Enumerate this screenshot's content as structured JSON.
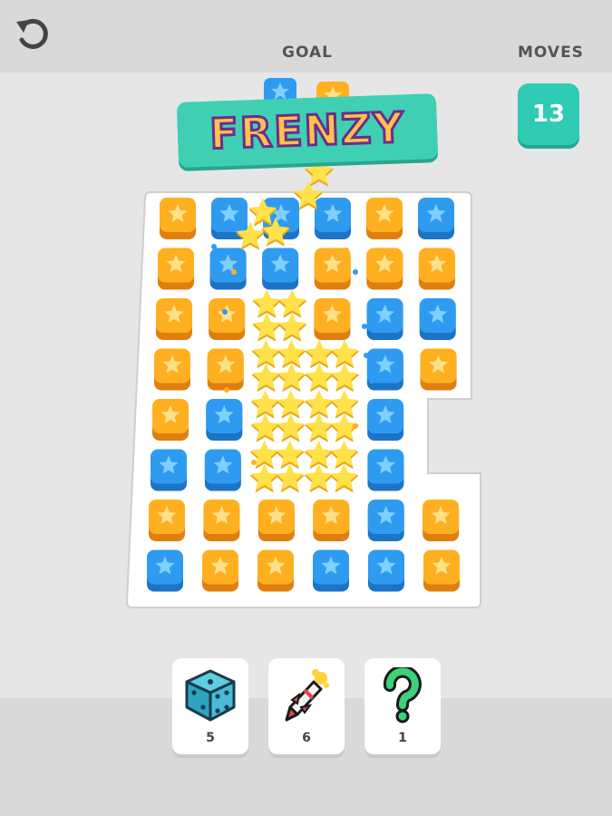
{
  "hud": {
    "goal_label": "GOAL",
    "moves_label": "MOVES",
    "moves_left": "13",
    "undo_icon": "undo-arrow-icon",
    "goal_tiles": [
      "blue-star",
      "orange-star"
    ]
  },
  "banner": {
    "text": "FRENZY"
  },
  "colors": {
    "blue_tile": "#2f9bf0",
    "orange_tile": "#ffb020",
    "star_burst": "#ffe24a",
    "accent_teal": "#2fcbb3"
  },
  "board": {
    "rows": [
      [
        "O",
        "B",
        "B",
        "B",
        "O",
        "B"
      ],
      [
        "O",
        "B",
        "B",
        "O",
        "O",
        "O"
      ],
      [
        "O",
        "O",
        "S",
        "O",
        "B",
        "B"
      ],
      [
        "O",
        "O",
        "S",
        "S",
        "B",
        "O"
      ],
      [
        "O",
        "B",
        "S",
        "S",
        "B",
        ""
      ],
      [
        "B",
        "B",
        "S",
        "S",
        "B",
        ""
      ],
      [
        "O",
        "O",
        "O",
        "O",
        "B",
        "O"
      ],
      [
        "B",
        "O",
        "O",
        "B",
        "B",
        "O"
      ]
    ],
    "legend": {
      "O": "orange-star-tile",
      "B": "blue-star-tile",
      "S": "star-burst"
    }
  },
  "boosters": [
    {
      "name": "dice",
      "icon": "dice-icon",
      "count": "5"
    },
    {
      "name": "rocket",
      "icon": "rocket-icon",
      "count": "6"
    },
    {
      "name": "mystery",
      "icon": "question-mark-icon",
      "count": "1"
    }
  ]
}
